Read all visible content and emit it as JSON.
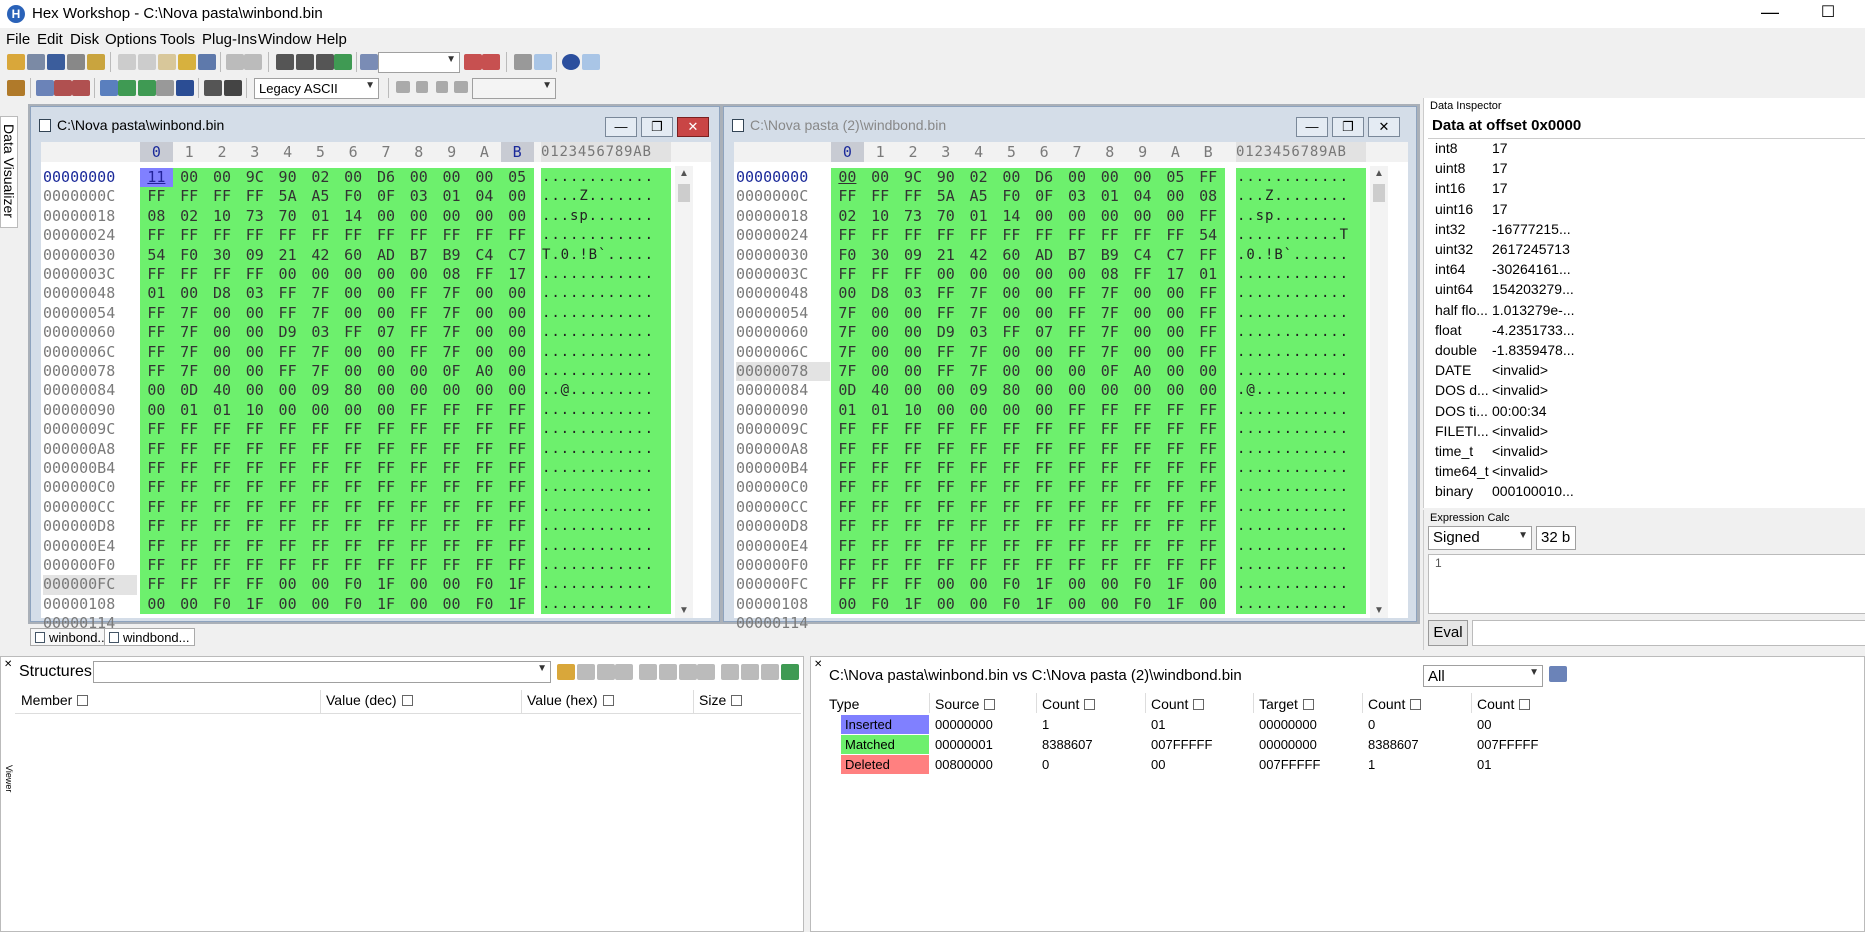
{
  "window": {
    "title": "Hex Workshop - C:\\Nova pasta\\winbond.bin",
    "app_icon": "H"
  },
  "menu": [
    "File",
    "Edit",
    "Disk",
    "Options",
    "Tools",
    "Plug-Ins",
    "Window",
    "Help"
  ],
  "toolbar": {
    "encoding_select": "Legacy ASCII",
    "search_value": ""
  },
  "side_tab": {
    "label": "Data Visualizer"
  },
  "doc_left": {
    "title": "C:\\Nova pasta\\winbond.bin",
    "header_cols": [
      "0",
      "1",
      "2",
      "3",
      "4",
      "5",
      "6",
      "7",
      "8",
      "9",
      "A",
      "B"
    ],
    "ascii_header": "0123456789AB",
    "offsets": [
      "00000000",
      "0000000C",
      "00000018",
      "00000024",
      "00000030",
      "0000003C",
      "00000048",
      "00000054",
      "00000060",
      "0000006C",
      "00000078",
      "00000084",
      "00000090",
      "0000009C",
      "000000A8",
      "000000B4",
      "000000C0",
      "000000CC",
      "000000D8",
      "000000E4",
      "000000F0",
      "000000FC",
      "00000108",
      "00000114"
    ],
    "rows": [
      "11 00 00 9C 90 02 00 D6 00 00 00 05",
      "FF FF FF FF 5A A5 F0 0F 03 01 04 00",
      "08 02 10 73 70 01 14 00 00 00 00 00",
      "FF FF FF FF FF FF FF FF FF FF FF FF",
      "54 F0 30 09 21 42 60 AD B7 B9 C4 C7",
      "FF FF FF FF 00 00 00 00 00 08 FF 17",
      "01 00 D8 03 FF 7F 00 00 FF 7F 00 00",
      "FF 7F 00 00 FF 7F 00 00 FF 7F 00 00",
      "FF 7F 00 00 D9 03 FF 07 FF 7F 00 00",
      "FF 7F 00 00 FF 7F 00 00 FF 7F 00 00",
      "FF 7F 00 00 FF 7F 00 00 00 0F A0 00",
      "00 0D 40 00 00 09 80 00 00 00 00 00",
      "00 01 01 10 00 00 00 00 FF FF FF FF",
      "FF FF FF FF FF FF FF FF FF FF FF FF",
      "FF FF FF FF FF FF FF FF FF FF FF FF",
      "FF FF FF FF FF FF FF FF FF FF FF FF",
      "FF FF FF FF FF FF FF FF FF FF FF FF",
      "FF FF FF FF FF FF FF FF FF FF FF FF",
      "FF FF FF FF FF FF FF FF FF FF FF FF",
      "FF FF FF FF FF FF FF FF FF FF FF FF",
      "FF FF FF FF FF FF FF FF FF FF FF FF",
      "FF FF FF FF 00 00 F0 1F 00 00 F0 1F",
      "00 00 F0 1F 00 00 F0 1F 00 00 F0 1F"
    ],
    "ascii": [
      "............",
      "....Z.......",
      "...sp.......",
      "............",
      "T.0.!B`.....",
      "............",
      "............",
      "............",
      "............",
      "............",
      "............",
      "..@.........",
      "............",
      "............",
      "............",
      "............",
      "............",
      "............",
      "............",
      "............",
      "............",
      "............",
      "............"
    ]
  },
  "doc_right": {
    "title": "C:\\Nova pasta (2)\\windbond.bin",
    "header_cols": [
      "0",
      "1",
      "2",
      "3",
      "4",
      "5",
      "6",
      "7",
      "8",
      "9",
      "A",
      "B"
    ],
    "ascii_header": "0123456789AB",
    "offsets": [
      "00000000",
      "0000000C",
      "00000018",
      "00000024",
      "00000030",
      "0000003C",
      "00000048",
      "00000054",
      "00000060",
      "0000006C",
      "00000078",
      "00000084",
      "00000090",
      "0000009C",
      "000000A8",
      "000000B4",
      "000000C0",
      "000000CC",
      "000000D8",
      "000000E4",
      "000000F0",
      "000000FC",
      "00000108",
      "00000114"
    ],
    "rows": [
      "00 00 9C 90 02 00 D6 00 00 00 05 FF",
      "FF FF FF 5A A5 F0 0F 03 01 04 00 08",
      "02 10 73 70 01 14 00 00 00 00 00 FF",
      "FF FF FF FF FF FF FF FF FF FF FF 54",
      "F0 30 09 21 42 60 AD B7 B9 C4 C7 FF",
      "FF FF FF 00 00 00 00 00 08 FF 17 01",
      "00 D8 03 FF 7F 00 00 FF 7F 00 00 FF",
      "7F 00 00 FF 7F 00 00 FF 7F 00 00 FF",
      "7F 00 00 D9 03 FF 07 FF 7F 00 00 FF",
      "7F 00 00 FF 7F 00 00 FF 7F 00 00 FF",
      "7F 00 00 FF 7F 00 00 00 0F A0 00 00",
      "0D 40 00 00 09 80 00 00 00 00 00 00",
      "01 01 10 00 00 00 00 FF FF FF FF FF",
      "FF FF FF FF FF FF FF FF FF FF FF FF",
      "FF FF FF FF FF FF FF FF FF FF FF FF",
      "FF FF FF FF FF FF FF FF FF FF FF FF",
      "FF FF FF FF FF FF FF FF FF FF FF FF",
      "FF FF FF FF FF FF FF FF FF FF FF FF",
      "FF FF FF FF FF FF FF FF FF FF FF FF",
      "FF FF FF FF FF FF FF FF FF FF FF FF",
      "FF FF FF FF FF FF FF FF FF FF FF FF",
      "FF FF FF 00 00 F0 1F 00 00 F0 1F 00",
      "00 F0 1F 00 00 F0 1F 00 00 F0 1F 00"
    ],
    "ascii": [
      "............",
      "...Z........",
      "..sp........",
      "...........T",
      ".0.!B`......",
      "............",
      "............",
      "............",
      "............",
      "............",
      "............",
      ".@..........",
      "............",
      "............",
      "............",
      "............",
      "............",
      "............",
      "............",
      "............",
      "............",
      "............",
      "............"
    ]
  },
  "tabs": [
    "winbond...",
    "windbond..."
  ],
  "inspector": {
    "title": "Data Inspector",
    "header": "Data at offset 0x0000",
    "rows": [
      {
        "k": "int8",
        "v": "17"
      },
      {
        "k": "uint8",
        "v": "17"
      },
      {
        "k": "int16",
        "v": "17"
      },
      {
        "k": "uint16",
        "v": "17"
      },
      {
        "k": "int32",
        "v": "-16777215..."
      },
      {
        "k": "uint32",
        "v": "2617245713"
      },
      {
        "k": "int64",
        "v": "-30264161..."
      },
      {
        "k": "uint64",
        "v": "154203279..."
      },
      {
        "k": "half flo...",
        "v": "1.013279e-..."
      },
      {
        "k": "float",
        "v": "-4.2351733..."
      },
      {
        "k": "double",
        "v": "-1.8359478..."
      },
      {
        "k": "DATE",
        "v": "<invalid>"
      },
      {
        "k": "DOS d...",
        "v": "<invalid>"
      },
      {
        "k": "DOS ti...",
        "v": "00:00:34"
      },
      {
        "k": "FILETI...",
        "v": "<invalid>"
      },
      {
        "k": "time_t",
        "v": "<invalid>"
      },
      {
        "k": "time64_t",
        "v": "<invalid>"
      },
      {
        "k": "binary",
        "v": "000100010..."
      }
    ]
  },
  "expr_calc": {
    "title": "Expression Calc",
    "mode": "Signed",
    "bits": "32 b",
    "line_number": "1",
    "eval_label": "Eval"
  },
  "structures": {
    "title": "Structures",
    "columns": [
      "Member",
      "Value (dec)",
      "Value (hex)",
      "Size"
    ],
    "side_label": "Viewer"
  },
  "compare": {
    "title": "C:\\Nova pasta\\winbond.bin vs C:\\Nova pasta (2)\\windbond.bin",
    "filter": "All",
    "columns": [
      "Type",
      "Source",
      "Count",
      "Count",
      "Target",
      "Count",
      "Count"
    ],
    "rows": [
      {
        "type": "Inserted",
        "color": "#8080ff",
        "c": [
          "00000000",
          "1",
          "01",
          "00000000",
          "0",
          "00"
        ]
      },
      {
        "type": "Matched",
        "color": "#6df06d",
        "c": [
          "00000001",
          "8388607",
          "007FFFFF",
          "00000000",
          "8388607",
          "007FFFFF"
        ]
      },
      {
        "type": "Deleted",
        "color": "#ff8080",
        "c": [
          "00800000",
          "0",
          "00",
          "007FFFFF",
          "1",
          "01"
        ]
      }
    ]
  }
}
